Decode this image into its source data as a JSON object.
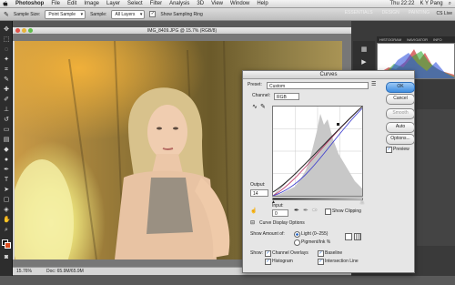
{
  "menubar": {
    "app": "Photoshop",
    "items": [
      "File",
      "Edit",
      "Image",
      "Layer",
      "Select",
      "Filter",
      "Analysis",
      "3D",
      "View",
      "Window",
      "Help"
    ],
    "clock": "Thu 22:22",
    "user": "K Y Pang"
  },
  "options": {
    "sample_size_label": "Sample Size:",
    "sample_size_value": "Point Sample",
    "sample_label": "Sample:",
    "sample_value": "All Layers",
    "show_ring_label": "Show Sampling Ring",
    "workspaces": [
      "ESSENTIALS",
      "DESIGN",
      "PAINTING"
    ],
    "cslive": "CS Live"
  },
  "document": {
    "title": "IMG_8409.JPG @ 15.7% (RGB/8)",
    "zoom": "15.76%",
    "doc_info": "Doc: 65.9M/65.9M"
  },
  "panels": {
    "tabs": [
      "HISTOGRAM",
      "NAVIGATOR",
      "INFO"
    ]
  },
  "curves": {
    "title": "Curves",
    "preset_label": "Preset:",
    "preset_value": "Custom",
    "channel_label": "Channel:",
    "channel_value": "RGB",
    "output_label": "Output:",
    "output_value": "14",
    "input_label": "Input:",
    "input_value": "0",
    "show_clipping": "Show Clipping",
    "display_options": "Curve Display Options",
    "show_amount_label": "Show Amount of:",
    "light_label": "Light (0–255)",
    "pigment_label": "Pigment/Ink %",
    "show_label": "Show:",
    "channel_overlays": "Channel Overlays",
    "baseline": "Baseline",
    "histogram": "Histogram",
    "intersection_line": "Intersection Line",
    "buttons": {
      "ok": "OK",
      "cancel": "Cancel",
      "smooth": "Smooth",
      "auto": "Auto",
      "options": "Options...",
      "preview": "Preview"
    }
  },
  "colors": {
    "ok_blue": "#3f8ee0",
    "curve_rgb": "#222222",
    "curve_blue": "#3a3acf",
    "curve_red": "#c0396a"
  }
}
